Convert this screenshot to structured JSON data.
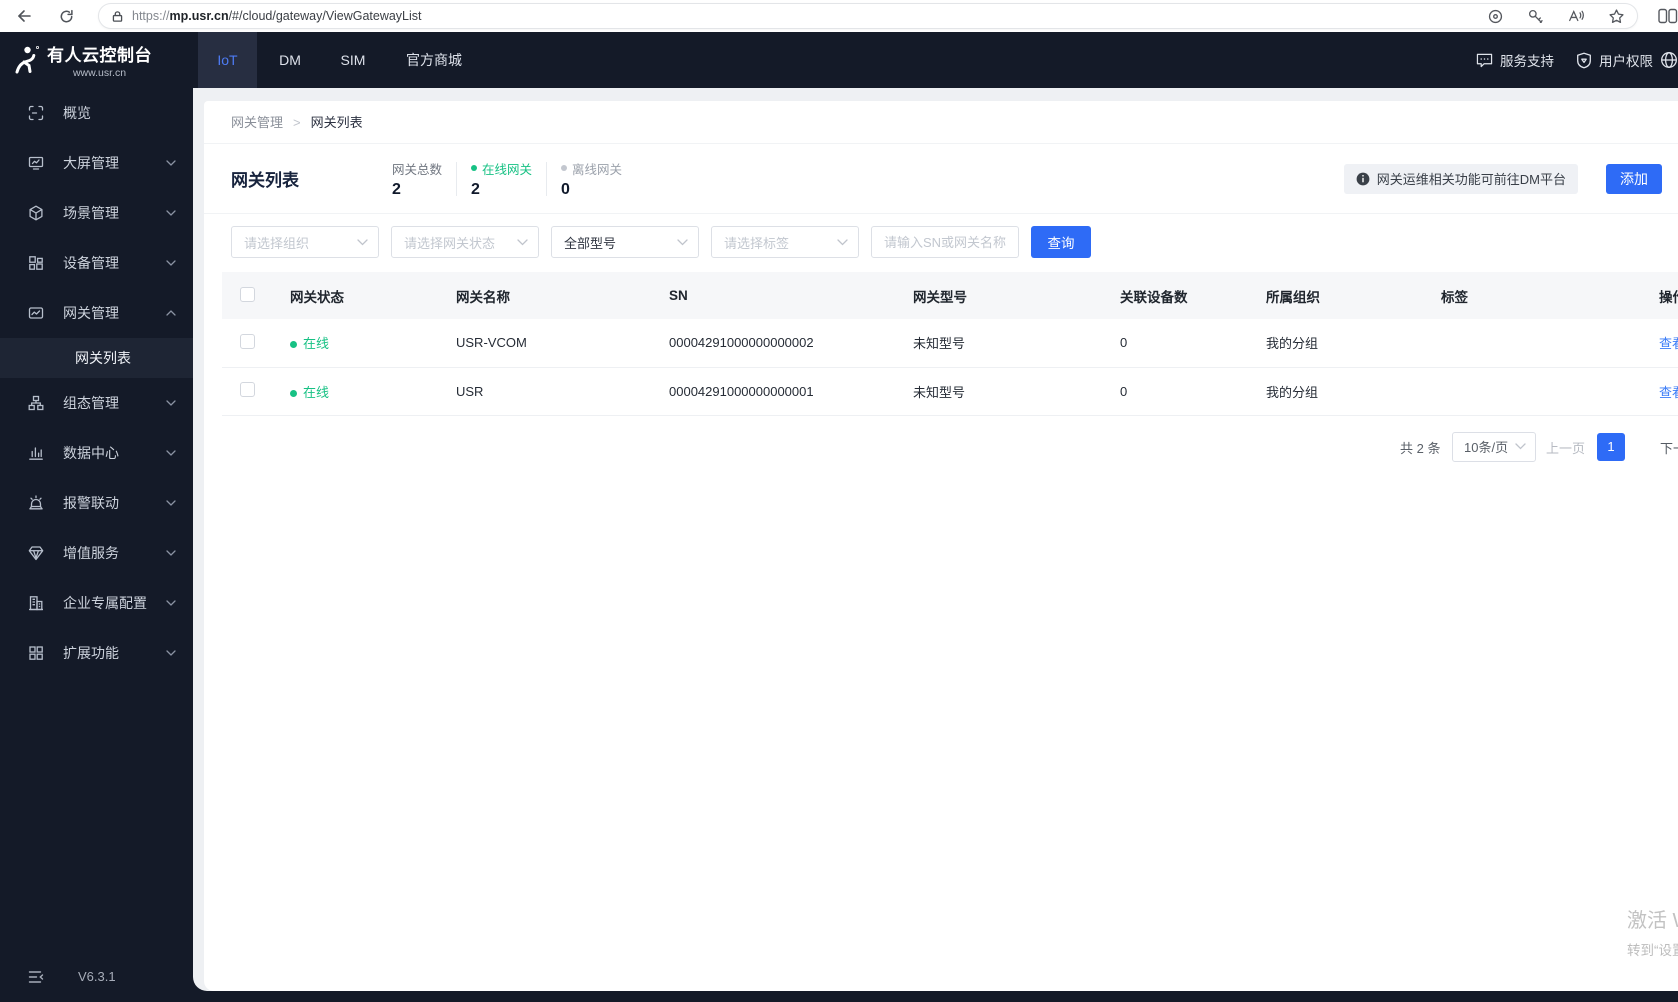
{
  "browser": {
    "url_prefix": "https://",
    "url_host": "mp.usr.cn",
    "url_path": "/#/cloud/gateway/ViewGatewayList"
  },
  "brand": {
    "title": "有人云控制台",
    "subtitle": "www.usr.cn"
  },
  "topnav": {
    "tabs": [
      {
        "label": "IoT",
        "active": true
      },
      {
        "label": "DM",
        "active": false
      },
      {
        "label": "SIM",
        "active": false
      },
      {
        "label": "官方商城",
        "active": false
      }
    ],
    "service_support": "服务支持",
    "user_permission": "用户权限"
  },
  "sidebar": {
    "items": [
      {
        "label": "概览",
        "icon": "overview-icon",
        "has_children": false
      },
      {
        "label": "大屏管理",
        "icon": "bigscreen-icon",
        "has_children": true
      },
      {
        "label": "场景管理",
        "icon": "scene-icon",
        "has_children": true
      },
      {
        "label": "设备管理",
        "icon": "device-icon",
        "has_children": true
      },
      {
        "label": "网关管理",
        "icon": "gateway-icon",
        "has_children": true,
        "expanded": true
      },
      {
        "label": "组态管理",
        "icon": "configuration-icon",
        "has_children": true
      },
      {
        "label": "数据中心",
        "icon": "data-center-icon",
        "has_children": true
      },
      {
        "label": "报警联动",
        "icon": "alarm-icon",
        "has_children": true
      },
      {
        "label": "增值服务",
        "icon": "value-added-icon",
        "has_children": true
      },
      {
        "label": "企业专属配置",
        "icon": "enterprise-icon",
        "has_children": true
      },
      {
        "label": "扩展功能",
        "icon": "extension-icon",
        "has_children": true
      }
    ],
    "active_submenu": "网关列表",
    "version": "V6.3.1"
  },
  "breadcrumb": {
    "parent": "网关管理",
    "separator": ">",
    "current": "网关列表"
  },
  "page": {
    "title": "网关列表",
    "stats": [
      {
        "label": "网关总数",
        "value": "2"
      },
      {
        "label": "在线网关",
        "value": "2",
        "dot_color": "#17c184"
      },
      {
        "label": "离线网关",
        "value": "0",
        "dot_color": "#c3c7cf"
      }
    ],
    "info_banner": "网关运维相关功能可前往DM平台",
    "add_button": "添加"
  },
  "filters": {
    "org_placeholder": "请选择组织",
    "status_placeholder": "请选择网关状态",
    "model_value": "全部型号",
    "tag_placeholder": "请选择标签",
    "search_placeholder": "请输入SN或网关名称",
    "query_button": "查询"
  },
  "table": {
    "headers": [
      "网关状态",
      "网关名称",
      "SN",
      "网关型号",
      "关联设备数",
      "所属组织",
      "标签",
      "操作"
    ],
    "rows": [
      {
        "status": "在线",
        "name": "USR-VCOM",
        "sn": "00004291000000000002",
        "model": "未知型号",
        "device_count": "0",
        "org": "我的分组",
        "tag": "",
        "action": "查看"
      },
      {
        "status": "在线",
        "name": "USR",
        "sn": "00004291000000000001",
        "model": "未知型号",
        "device_count": "0",
        "org": "我的分组",
        "tag": "",
        "action": "查看"
      }
    ]
  },
  "pagination": {
    "total": "共 2 条",
    "page_size": "10条/页",
    "prev": "上一页",
    "current_page": "1",
    "next": "下一页"
  },
  "watermark": {
    "line1": "激活 Windows",
    "line2": "转到“设置”以激活"
  },
  "colors": {
    "accent": "#2e6bf6",
    "online_green": "#17c184",
    "offline_gray": "#c3c7cf",
    "dark_bg": "#141a28"
  }
}
